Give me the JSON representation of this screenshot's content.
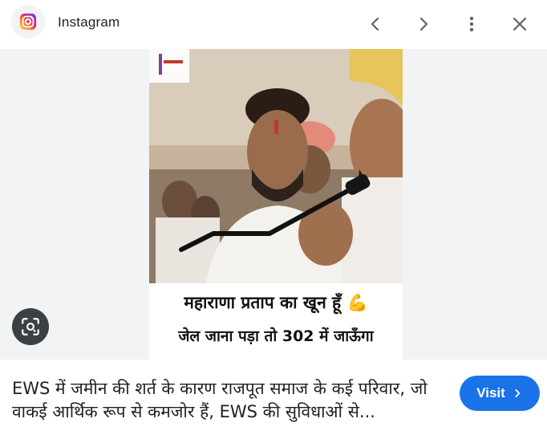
{
  "header": {
    "app_name": "Instagram",
    "icons": {
      "app": "instagram-logo-icon",
      "back": "chevron-left-icon",
      "forward": "chevron-right-icon",
      "more": "more-vert-icon",
      "close": "close-icon"
    }
  },
  "viewer": {
    "lens_icon": "lens-icon",
    "caption": {
      "line1": "महाराणा प्रताप का खून हूँ 💪",
      "line2": "जेल जाना पड़ा तो 302 में जाऊँगा"
    }
  },
  "result": {
    "description": "EWS में जमीन की शर्त के कारण राजपूत समाज के कई परिवार, जो वाकई आर्थिक रूप से कमजोर हैं, EWS की सुविधाओं से...",
    "visit_label": "Visit",
    "visit_icon": "chevron-right-icon"
  },
  "colors": {
    "accent": "#1a73e8",
    "viewer_bg": "#f1f3f4",
    "text": "#202124"
  }
}
